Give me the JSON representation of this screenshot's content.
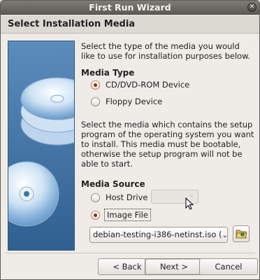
{
  "window": {
    "title": "First Run Wizard",
    "close_glyph": "✕"
  },
  "header": {
    "title": "Select Installation Media"
  },
  "intro_text": "Select the type of the media you would like to use for installation purposes below.",
  "media_type": {
    "heading": "Media Type",
    "options": [
      {
        "label": "CD/DVD-ROM Device",
        "selected": true
      },
      {
        "label": "Floppy Device",
        "selected": false
      }
    ]
  },
  "media_source_text": "Select the media which contains the setup program of the operating system you want to install. This media must be bootable, otherwise the setup program will not be able to start.",
  "media_source": {
    "heading": "Media Source",
    "options": [
      {
        "label": "Host Drive",
        "selected": false
      },
      {
        "label": "Image File",
        "selected": true
      }
    ],
    "host_drive_value": "",
    "image_file_value": "debian-testing-i386-netinst.iso (",
    "image_file_suffix": "( ⌄ )",
    "folder_icon": "folder-open-icon"
  },
  "buttons": {
    "back": "< Back",
    "next": "Next >",
    "cancel": "Cancel"
  },
  "colors": {
    "art_bg": "#3f74a6",
    "titlebar": "#5d5b57",
    "window_bg": "#efebe7"
  }
}
